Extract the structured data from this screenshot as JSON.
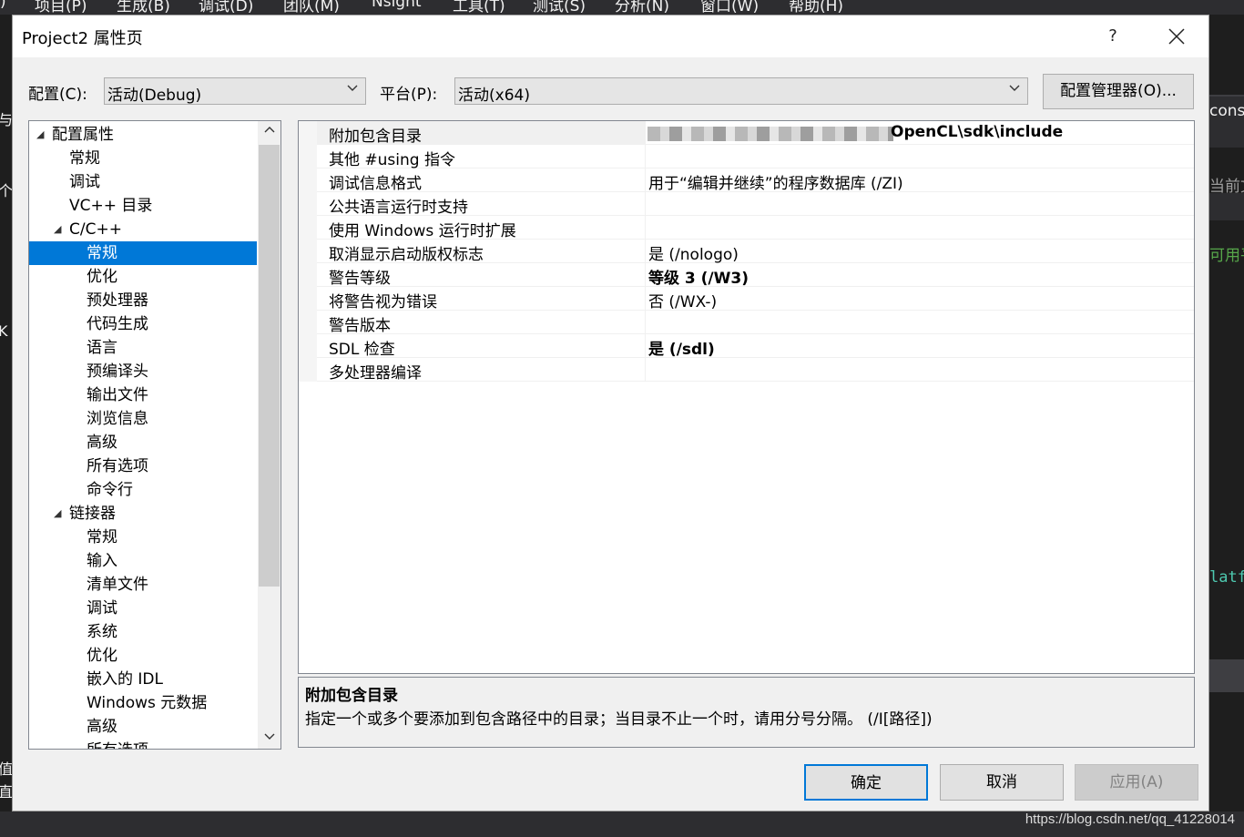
{
  "ide": {
    "menu": [
      "项目(P)",
      "生成(B)",
      "调试(D)",
      "团队(M)",
      "Nsight",
      "工具(T)",
      "测试(S)",
      "分析(N)",
      "窗口(W)",
      "帮助(H)"
    ],
    "right_fragments": [
      "cons",
      "当前文",
      "可用平",
      "latf"
    ],
    "left_fragments": [
      "与",
      "个",
      "K",
      "值",
      "直"
    ]
  },
  "dialog": {
    "title": "Project2 属性页",
    "help_glyph": "?",
    "close_glyph": "✕",
    "config_label": "配置(C):",
    "config_value": "活动(Debug)",
    "platform_label": "平台(P):",
    "platform_value": "活动(x64)",
    "config_manager_button": "配置管理器(O)..."
  },
  "tree": [
    {
      "label": "配置属性",
      "level": 0,
      "expanded": true
    },
    {
      "label": "常规",
      "level": 1
    },
    {
      "label": "调试",
      "level": 1
    },
    {
      "label": "VC++ 目录",
      "level": 1
    },
    {
      "label": "C/C++",
      "level": 1,
      "expanded": true
    },
    {
      "label": "常规",
      "level": 2,
      "selected": true
    },
    {
      "label": "优化",
      "level": 2
    },
    {
      "label": "预处理器",
      "level": 2
    },
    {
      "label": "代码生成",
      "level": 2
    },
    {
      "label": "语言",
      "level": 2
    },
    {
      "label": "预编译头",
      "level": 2
    },
    {
      "label": "输出文件",
      "level": 2
    },
    {
      "label": "浏览信息",
      "level": 2
    },
    {
      "label": "高级",
      "level": 2
    },
    {
      "label": "所有选项",
      "level": 2
    },
    {
      "label": "命令行",
      "level": 2
    },
    {
      "label": "链接器",
      "level": 1,
      "expanded": true
    },
    {
      "label": "常规",
      "level": 2
    },
    {
      "label": "输入",
      "level": 2
    },
    {
      "label": "清单文件",
      "level": 2
    },
    {
      "label": "调试",
      "level": 2
    },
    {
      "label": "系统",
      "level": 2
    },
    {
      "label": "优化",
      "level": 2
    },
    {
      "label": "嵌入的 IDL",
      "level": 2
    },
    {
      "label": "Windows 元数据",
      "level": 2
    },
    {
      "label": "高级",
      "level": 2
    },
    {
      "label": "所有选项",
      "level": 2
    }
  ],
  "properties": [
    {
      "name": "附加包含目录",
      "value": "OpenCL\\sdk\\include",
      "bold": true,
      "blurred_prefix": true
    },
    {
      "name": "其他 #using 指令",
      "value": ""
    },
    {
      "name": "调试信息格式",
      "value": "用于“编辑并继续”的程序数据库 (/ZI)"
    },
    {
      "name": "公共语言运行时支持",
      "value": ""
    },
    {
      "name": "使用 Windows 运行时扩展",
      "value": ""
    },
    {
      "name": "取消显示启动版权标志",
      "value": "是 (/nologo)"
    },
    {
      "name": "警告等级",
      "value": "等级 3 (/W3)",
      "bold": true
    },
    {
      "name": "将警告视为错误",
      "value": "否 (/WX-)"
    },
    {
      "name": "警告版本",
      "value": ""
    },
    {
      "name": "SDL 检查",
      "value": "是 (/sdl)",
      "bold": true
    },
    {
      "name": "多处理器编译",
      "value": ""
    }
  ],
  "description": {
    "title": "附加包含目录",
    "text": "指定一个或多个要添加到包含路径中的目录；当目录不止一个时，请用分号分隔。     (/I[路径])"
  },
  "buttons": {
    "ok": "确定",
    "cancel": "取消",
    "apply": "应用(A)"
  },
  "watermark": "https://blog.csdn.net/qq_41228014"
}
